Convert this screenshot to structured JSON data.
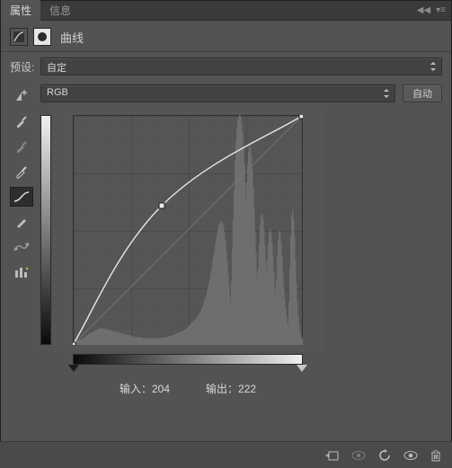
{
  "tabs": {
    "properties": "属性",
    "info": "信息"
  },
  "title": "曲线",
  "preset": {
    "label": "预设:",
    "value": "自定"
  },
  "channel": {
    "value": "RGB",
    "auto_button": "自动"
  },
  "io": {
    "input_label": "输入：",
    "input_value": "204",
    "output_label": "输出：",
    "output_value": "222"
  },
  "tools": {
    "eyedropper": "eyedropper",
    "eyedropper_plus": "eyedropper-plus",
    "eyedropper_minus": "eyedropper-minus",
    "curve_draw": "curve-draw",
    "pencil": "pencil",
    "smooth": "smooth",
    "clip_warn": "clip-warn"
  },
  "chart_data": {
    "type": "curves-histogram",
    "title": "RGB Curves",
    "xlabel": "Input",
    "ylabel": "Output",
    "xlim": [
      0,
      255
    ],
    "ylim": [
      0,
      255
    ],
    "curve_points": [
      {
        "x": 0,
        "y": 0
      },
      {
        "x": 99,
        "y": 155
      },
      {
        "x": 255,
        "y": 255
      }
    ],
    "input": 204,
    "output": 222,
    "histogram": [
      2,
      3,
      3,
      4,
      4,
      4,
      5,
      5,
      6,
      6,
      7,
      7,
      8,
      8,
      9,
      10,
      10,
      11,
      12,
      12,
      13,
      13,
      14,
      14,
      15,
      15,
      16,
      16,
      17,
      17,
      17,
      17,
      17,
      17,
      17,
      17,
      16,
      16,
      16,
      16,
      15,
      15,
      15,
      15,
      14,
      14,
      14,
      14,
      13,
      13,
      13,
      13,
      12,
      12,
      12,
      12,
      11,
      11,
      11,
      11,
      10,
      10,
      10,
      10,
      9,
      9,
      9,
      9,
      8,
      8,
      8,
      8,
      8,
      8,
      8,
      8,
      7,
      7,
      7,
      7,
      7,
      7,
      7,
      7,
      7,
      7,
      7,
      7,
      7,
      7,
      7,
      7,
      7,
      7,
      7,
      7,
      7,
      7,
      7,
      7,
      8,
      8,
      8,
      8,
      8,
      8,
      9,
      9,
      9,
      9,
      10,
      10,
      10,
      11,
      11,
      12,
      12,
      12,
      13,
      13,
      14,
      14,
      15,
      15,
      16,
      16,
      17,
      18,
      19,
      20,
      21,
      22,
      23,
      24,
      25,
      26,
      27,
      28,
      29,
      31,
      32,
      34,
      36,
      38,
      40,
      43,
      46,
      49,
      52,
      56,
      60,
      64,
      68,
      74,
      80,
      86,
      92,
      98,
      104,
      110,
      116,
      120,
      124,
      126,
      128,
      128,
      126,
      122,
      116,
      108,
      98,
      86,
      74,
      62,
      50,
      42,
      66,
      100,
      130,
      160,
      190,
      210,
      224,
      232,
      236,
      238,
      236,
      230,
      220,
      206,
      188,
      168,
      150,
      168,
      188,
      200,
      206,
      204,
      196,
      182,
      164,
      142,
      118,
      96,
      76,
      64,
      80,
      104,
      124,
      134,
      136,
      130,
      118,
      102,
      86,
      72,
      88,
      104,
      116,
      120,
      116,
      106,
      92,
      76,
      60,
      48,
      68,
      92,
      110,
      118,
      116,
      106,
      92,
      76,
      60,
      48,
      38,
      30,
      24,
      20,
      44,
      80,
      112,
      134,
      140,
      130,
      112,
      88,
      64,
      44,
      30,
      20,
      14,
      10,
      8,
      6
    ]
  }
}
